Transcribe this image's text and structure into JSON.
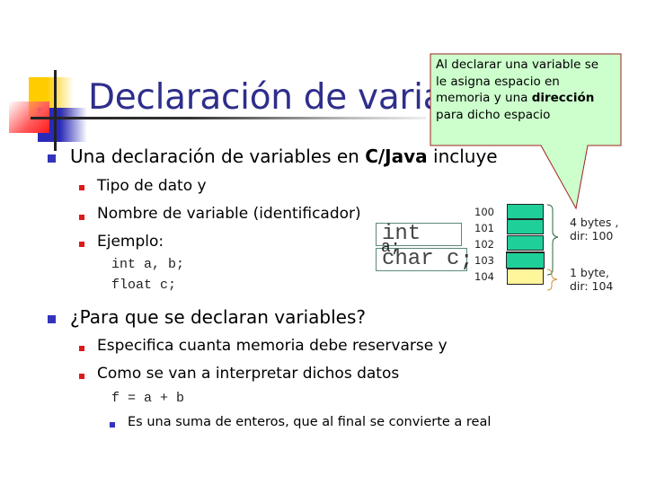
{
  "slide": {
    "title": "Declaración de variables",
    "title_color": "#2e2e8c",
    "callout": {
      "line1": "Al declarar una variable se",
      "line2": "le asigna espacio en",
      "line3_prefix": "memoria y una ",
      "line3_bold": "dirección",
      "line4": "para dicho espacio",
      "fill_color": "#ccffcc",
      "border_color": "#a02020"
    },
    "bullets": [
      {
        "text_prefix": "Una declaración de variables en ",
        "text_bold": "C/Java",
        "text_suffix": " incluye",
        "children": [
          {
            "text": "Tipo de dato y"
          },
          {
            "text": "Nombre de variable (identificador)"
          },
          {
            "text": "Ejemplo:"
          }
        ],
        "code": [
          "int a, b;",
          "float c;"
        ]
      },
      {
        "text": "¿Para que se declaran variables?",
        "children": [
          {
            "text": "Especifica cuanta memoria debe reservarse y"
          },
          {
            "text": "Como se van a interpretar dichos datos"
          }
        ],
        "code": [
          "f = a + b"
        ],
        "subchildren": [
          {
            "text": "Es una suma de enteros, que al final se convierte a real"
          }
        ]
      }
    ],
    "code_boxes": {
      "int_decl": "int",
      "int_decl_overflow": "a;",
      "char_decl": "char c",
      "char_semicolon": ";"
    },
    "memory": {
      "addresses": [
        "100",
        "101",
        "102",
        "103",
        "104"
      ],
      "cells": [
        {
          "type": "int",
          "color": "#1fcf9a"
        },
        {
          "type": "int",
          "color": "#1fcf9a"
        },
        {
          "type": "int",
          "color": "#1fcf9a"
        },
        {
          "type": "int",
          "color": "#1fcf9a"
        },
        {
          "type": "char",
          "color": "#fff59a"
        }
      ],
      "group_int": {
        "line1": "4 bytes ,",
        "line2": "dir: 100"
      },
      "group_char": {
        "line1": "1 byte,",
        "line2": "dir: 104"
      }
    }
  }
}
